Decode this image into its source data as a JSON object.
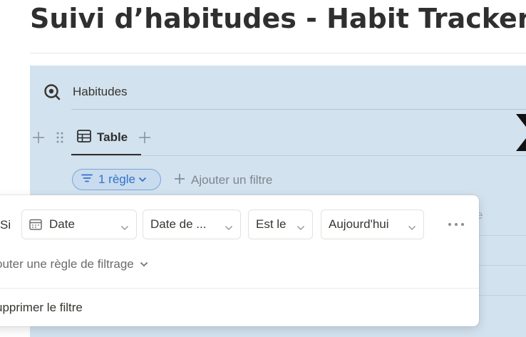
{
  "page": {
    "title": "Suivi d’habitudes - Habit Tracker"
  },
  "database": {
    "name": "Habitudes",
    "icon": "database-search-icon",
    "views": [
      {
        "label": "Table",
        "icon": "table-icon",
        "active": true
      }
    ]
  },
  "filter_bar": {
    "rule_chip_label": "1 règle",
    "add_filter_label": "Ajouter un filtre"
  },
  "filter_popover": {
    "prefix": "Si",
    "rule": {
      "property": "Date",
      "property_icon": "calendar-icon",
      "date_field": "Date de ...",
      "operator": "Est le",
      "value": "Aujourd'hui"
    },
    "add_rule_label": "outer une règle de filtrage",
    "delete_filter_label": "upprimer le filtre"
  },
  "background": {
    "column_hint": "ie"
  },
  "colors": {
    "panel_bg": "#d3e2ef",
    "chip_text": "#2f73c8",
    "chip_border": "#7aa7d8"
  }
}
